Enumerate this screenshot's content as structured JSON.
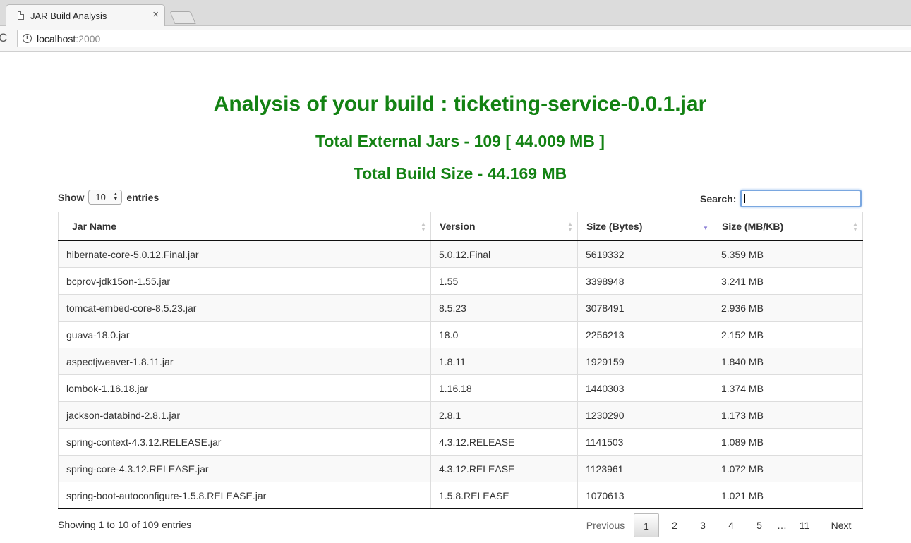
{
  "browser": {
    "tab_title": "JAR Build Analysis",
    "tab_close": "×",
    "url_host": "localhost",
    "url_port": ":2000",
    "reload_glyph": "C",
    "info_glyph": "i"
  },
  "page": {
    "title": "Analysis of your build : ticketing-service-0.0.1.jar",
    "external_jars": "Total External Jars - 109 [ 44.009 MB ]",
    "build_size": "Total Build Size - 44.169 MB",
    "accent_color": "#138213"
  },
  "controls": {
    "show_label": "Show",
    "entries_value": "10",
    "entries_label": "entries",
    "search_label": "Search:",
    "search_value": ""
  },
  "table": {
    "columns": [
      {
        "label": "Jar Name",
        "sort": "none"
      },
      {
        "label": "Version",
        "sort": "none"
      },
      {
        "label": "Size (Bytes)",
        "sort": "descending"
      },
      {
        "label": "Size (MB/KB)",
        "sort": "none"
      }
    ],
    "rows": [
      [
        "hibernate-core-5.0.12.Final.jar",
        "5.0.12.Final",
        "5619332",
        "5.359 MB"
      ],
      [
        "bcprov-jdk15on-1.55.jar",
        "1.55",
        "3398948",
        "3.241 MB"
      ],
      [
        "tomcat-embed-core-8.5.23.jar",
        "8.5.23",
        "3078491",
        "2.936 MB"
      ],
      [
        "guava-18.0.jar",
        "18.0",
        "2256213",
        "2.152 MB"
      ],
      [
        "aspectjweaver-1.8.11.jar",
        "1.8.11",
        "1929159",
        "1.840 MB"
      ],
      [
        "lombok-1.16.18.jar",
        "1.16.18",
        "1440303",
        "1.374 MB"
      ],
      [
        "jackson-databind-2.8.1.jar",
        "2.8.1",
        "1230290",
        "1.173 MB"
      ],
      [
        "spring-context-4.3.12.RELEASE.jar",
        "4.3.12.RELEASE",
        "1141503",
        "1.089 MB"
      ],
      [
        "spring-core-4.3.12.RELEASE.jar",
        "4.3.12.RELEASE",
        "1123961",
        "1.072 MB"
      ],
      [
        "spring-boot-autoconfigure-1.5.8.RELEASE.jar",
        "1.5.8.RELEASE",
        "1070613",
        "1.021 MB"
      ]
    ]
  },
  "footer": {
    "info": "Showing 1 to 10 of 109 entries",
    "previous": "Previous",
    "pages": [
      "1",
      "2",
      "3",
      "4",
      "5"
    ],
    "ellipsis": "…",
    "last_page": "11",
    "next": "Next",
    "current_page": "1"
  }
}
